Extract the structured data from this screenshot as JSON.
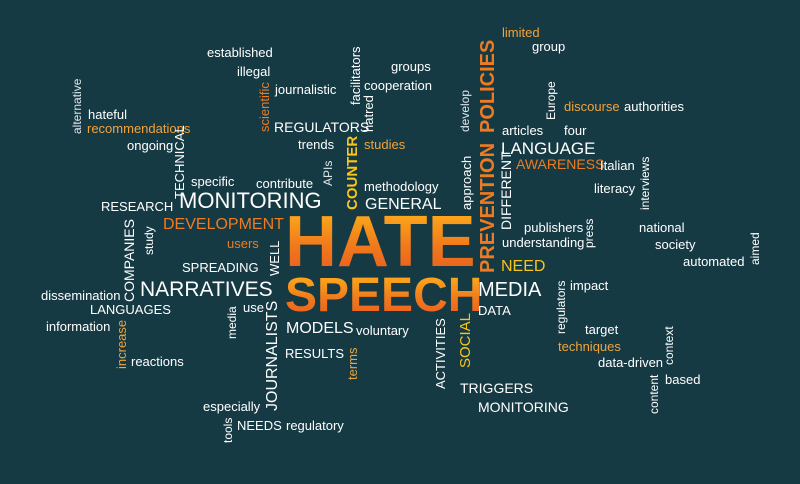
{
  "colors": {
    "background": "#163a44",
    "white": "#ffffff",
    "light": "#dfe6e8",
    "orange": "#ee7b22",
    "gold": "#f2a33a",
    "yellow": "#f7c51c"
  },
  "words": [
    {
      "text": "established"
    },
    {
      "text": "illegal"
    },
    {
      "text": "journalistic"
    },
    {
      "text": "groups"
    },
    {
      "text": "cooperation"
    },
    {
      "text": "facilitators"
    },
    {
      "text": "hatred"
    },
    {
      "text": "scientific"
    },
    {
      "text": "alternative"
    },
    {
      "text": "hateful"
    },
    {
      "text": "recommendations"
    },
    {
      "text": "ongoing"
    },
    {
      "text": "TECHNICAL"
    },
    {
      "text": "REGULATORS"
    },
    {
      "text": "trends"
    },
    {
      "text": "studies"
    },
    {
      "text": "specific"
    },
    {
      "text": "contribute"
    },
    {
      "text": "APIs"
    },
    {
      "text": "COUNTER"
    },
    {
      "text": "methodology"
    },
    {
      "text": "MONITORING"
    },
    {
      "text": "GENERAL"
    },
    {
      "text": "RESEARCH"
    },
    {
      "text": "DEVELOPMENT"
    },
    {
      "text": "users"
    },
    {
      "text": "COMPANIES"
    },
    {
      "text": "study"
    },
    {
      "text": "WELL"
    },
    {
      "text": "SPREADING"
    },
    {
      "text": "HATE"
    },
    {
      "text": "SPEECH"
    },
    {
      "text": "NARRATIVES"
    },
    {
      "text": "dissemination"
    },
    {
      "text": "LANGUAGES"
    },
    {
      "text": "information"
    },
    {
      "text": "increase"
    },
    {
      "text": "reactions"
    },
    {
      "text": "media"
    },
    {
      "text": "use"
    },
    {
      "text": "JOURNALISTS"
    },
    {
      "text": "MODELS"
    },
    {
      "text": "voluntary"
    },
    {
      "text": "RESULTS"
    },
    {
      "text": "terms"
    },
    {
      "text": "especially"
    },
    {
      "text": "tools"
    },
    {
      "text": "NEEDS"
    },
    {
      "text": "regulatory"
    },
    {
      "text": "ACTIVITIES"
    },
    {
      "text": "SOCIAL"
    },
    {
      "text": "TRIGGERS"
    },
    {
      "text": "MONITORING"
    },
    {
      "text": "develop"
    },
    {
      "text": "approach"
    },
    {
      "text": "PREVENTION"
    },
    {
      "text": "POLICIES"
    },
    {
      "text": "DIFFERENT"
    },
    {
      "text": "limited"
    },
    {
      "text": "group"
    },
    {
      "text": "Europe"
    },
    {
      "text": "discourse"
    },
    {
      "text": "authorities"
    },
    {
      "text": "articles"
    },
    {
      "text": "four"
    },
    {
      "text": "LANGUAGE"
    },
    {
      "text": "AWARENESS"
    },
    {
      "text": "Italian"
    },
    {
      "text": "literacy"
    },
    {
      "text": "interviews"
    },
    {
      "text": "publishers"
    },
    {
      "text": "press"
    },
    {
      "text": "understanding"
    },
    {
      "text": "national"
    },
    {
      "text": "society"
    },
    {
      "text": "aimed"
    },
    {
      "text": "automated"
    },
    {
      "text": "NEED"
    },
    {
      "text": "MEDIA"
    },
    {
      "text": "regulators"
    },
    {
      "text": "impact"
    },
    {
      "text": "DATA"
    },
    {
      "text": "target"
    },
    {
      "text": "techniques"
    },
    {
      "text": "data-driven"
    },
    {
      "text": "context"
    },
    {
      "text": "content"
    },
    {
      "text": "based"
    }
  ]
}
